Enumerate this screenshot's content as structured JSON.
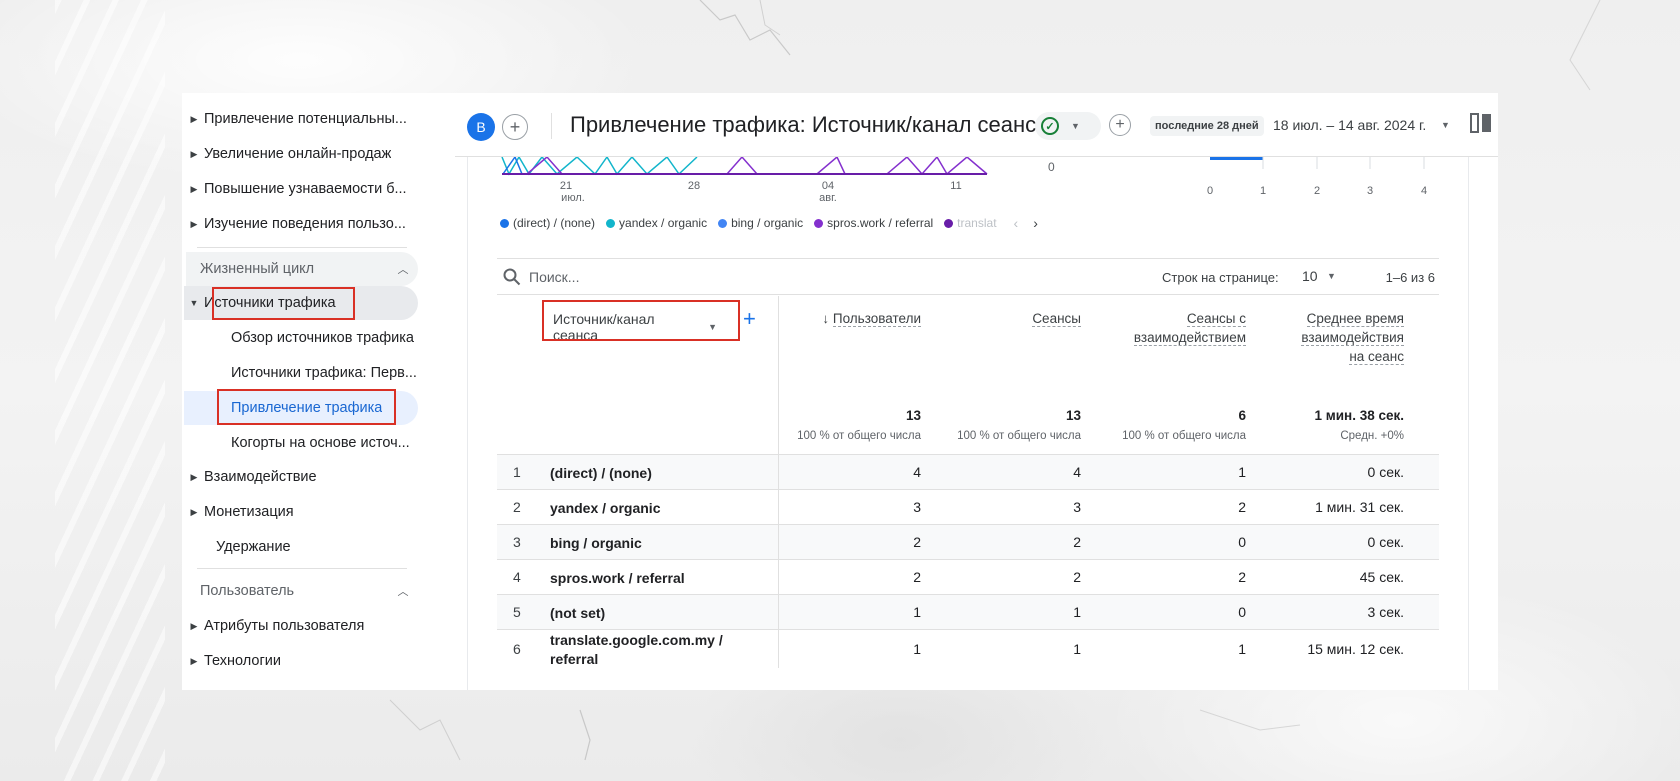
{
  "header": {
    "avatar_letter": "B",
    "title": "Привлечение трафика: Источник/канал сеанса",
    "date_badge": "последние 28 дней",
    "date_range": "18 июл. – 14 авг. 2024 г."
  },
  "sidebar": {
    "top_items": [
      {
        "label": "Привлечение потенциальны..."
      },
      {
        "label": "Увеличение онлайн-продаж"
      },
      {
        "label": "Повышение узнаваемости б..."
      },
      {
        "label": "Изучение поведения пользо..."
      }
    ],
    "lifecycle_title": "Жизненный цикл",
    "traffic_sources": "Источники трафика",
    "sub_items": [
      {
        "label": "Обзор источников трафика"
      },
      {
        "label": "Источники трафика: Перв..."
      },
      {
        "label": "Привлечение трафика"
      },
      {
        "label": "Когорты на основе источ..."
      }
    ],
    "lifecycle_items": [
      {
        "label": "Взаимодействие"
      },
      {
        "label": "Монетизация"
      },
      {
        "label": "Удержание"
      }
    ],
    "user_title": "Пользователь",
    "user_items": [
      {
        "label": "Атрибуты пользователя"
      },
      {
        "label": "Технологии"
      }
    ]
  },
  "chart": {
    "x_ticks": [
      {
        "day": "21",
        "month": "июл."
      },
      {
        "day": "28",
        "month": ""
      },
      {
        "day": "04",
        "month": "авг."
      },
      {
        "day": "11",
        "month": ""
      }
    ],
    "y_zero": "0",
    "bar_ticks": [
      "0",
      "1",
      "2",
      "3",
      "4"
    ],
    "legend": [
      {
        "label": "(direct) / (none)",
        "color": "#1a73e8"
      },
      {
        "label": "yandex / organic",
        "color": "#12b5cb"
      },
      {
        "label": "bing / organic",
        "color": "#4285f4"
      },
      {
        "label": "spros.work / referral",
        "color": "#8430ce"
      },
      {
        "label": "translat",
        "color": "#681da8"
      }
    ]
  },
  "table": {
    "search_placeholder": "Поиск...",
    "rows_label": "Строк на странице:",
    "rows_value": "10",
    "pager": "1–6 из 6",
    "dimension": "Источник/канал сеанса",
    "sort_arrow": "↓",
    "columns": [
      {
        "line1": "Пользователи",
        "line2": "",
        "line3": ""
      },
      {
        "line1": "Сеансы",
        "line2": "",
        "line3": ""
      },
      {
        "line1": "Сеансы с",
        "line2": "взаимодействием",
        "line3": ""
      },
      {
        "line1": "Среднее время",
        "line2": "взаимодействия",
        "line3": "на сеанс"
      }
    ],
    "totals": [
      {
        "value": "13",
        "sub": "100 % от общего числа"
      },
      {
        "value": "13",
        "sub": "100 % от общего числа"
      },
      {
        "value": "6",
        "sub": "100 % от общего числа"
      },
      {
        "value": "1 мин. 38 сек.",
        "sub": "Средн. +0%"
      }
    ],
    "rows": [
      {
        "idx": "1",
        "dim": "(direct) / (none)",
        "users": "4",
        "sessions": "4",
        "engaged": "1",
        "avg": "0 сек."
      },
      {
        "idx": "2",
        "dim": "yandex / organic",
        "users": "3",
        "sessions": "3",
        "engaged": "2",
        "avg": "1 мин. 31 сек."
      },
      {
        "idx": "3",
        "dim": "bing / organic",
        "users": "2",
        "sessions": "2",
        "engaged": "0",
        "avg": "0 сек."
      },
      {
        "idx": "4",
        "dim": "spros.work / referral",
        "users": "2",
        "sessions": "2",
        "engaged": "2",
        "avg": "45 сек."
      },
      {
        "idx": "5",
        "dim": "(not set)",
        "users": "1",
        "sessions": "1",
        "engaged": "0",
        "avg": "3 сек."
      },
      {
        "idx": "6",
        "dim": "translate.google.com.my / referral",
        "users": "1",
        "sessions": "1",
        "engaged": "1",
        "avg": "15 мин. 12 сек."
      }
    ]
  }
}
